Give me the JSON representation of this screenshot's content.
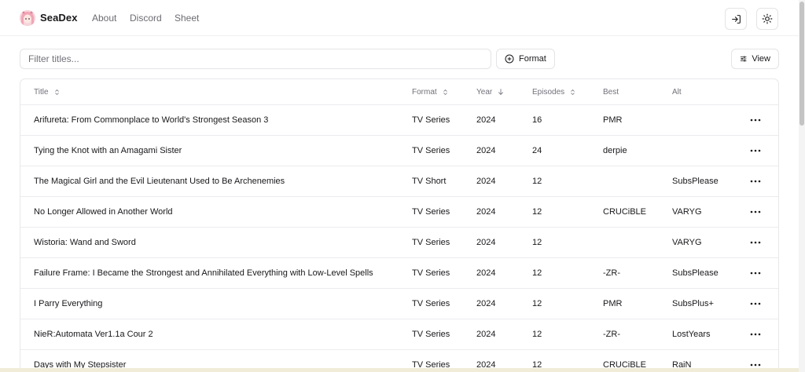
{
  "brand": {
    "name": "SeaDex",
    "logo_icon": "anime-girl-avatar-icon"
  },
  "nav": {
    "links": [
      "About",
      "Discord",
      "Sheet"
    ]
  },
  "header_actions": {
    "login_icon": "login-icon",
    "theme_icon": "sun-icon"
  },
  "toolbar": {
    "filter_placeholder": "Filter titles...",
    "format_label": "Format",
    "view_label": "View"
  },
  "table": {
    "headers": {
      "title": "Title",
      "format": "Format",
      "year": "Year",
      "episodes": "Episodes",
      "best": "Best",
      "alt": "Alt"
    },
    "rows": [
      {
        "title": "Arifureta: From Commonplace to World's Strongest Season 3",
        "format": "TV Series",
        "year": "2024",
        "episodes": "16",
        "best": "PMR",
        "alt": ""
      },
      {
        "title": "Tying the Knot with an Amagami Sister",
        "format": "TV Series",
        "year": "2024",
        "episodes": "24",
        "best": "derpie",
        "alt": ""
      },
      {
        "title": "The Magical Girl and the Evil Lieutenant Used to Be Archenemies",
        "format": "TV Short",
        "year": "2024",
        "episodes": "12",
        "best": "",
        "alt": "SubsPlease"
      },
      {
        "title": "No Longer Allowed in Another World",
        "format": "TV Series",
        "year": "2024",
        "episodes": "12",
        "best": "CRUCiBLE",
        "alt": "VARYG"
      },
      {
        "title": "Wistoria: Wand and Sword",
        "format": "TV Series",
        "year": "2024",
        "episodes": "12",
        "best": "",
        "alt": "VARYG"
      },
      {
        "title": "Failure Frame: I Became the Strongest and Annihilated Everything with Low-Level Spells",
        "format": "TV Series",
        "year": "2024",
        "episodes": "12",
        "best": "-ZR-",
        "alt": "SubsPlease"
      },
      {
        "title": "I Parry Everything",
        "format": "TV Series",
        "year": "2024",
        "episodes": "12",
        "best": "PMR",
        "alt": "SubsPlus+"
      },
      {
        "title": "NieR:Automata Ver1.1a Cour 2",
        "format": "TV Series",
        "year": "2024",
        "episodes": "12",
        "best": "-ZR-",
        "alt": "LostYears"
      },
      {
        "title": "Days with My Stepsister",
        "format": "TV Series",
        "year": "2024",
        "episodes": "12",
        "best": "CRUCiBLE",
        "alt": "RaiN"
      }
    ]
  },
  "colors": {
    "text": "#18181b",
    "muted": "#71717a",
    "border": "#e4e4e7",
    "background": "#ffffff"
  }
}
